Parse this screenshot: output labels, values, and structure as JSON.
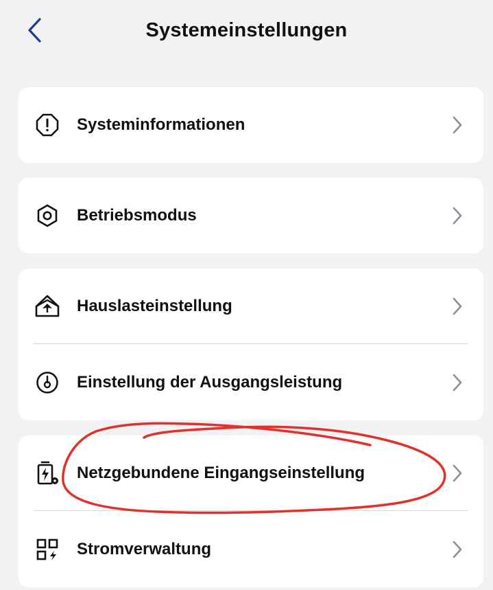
{
  "header": {
    "title": "Systemeinstellungen",
    "back_icon": "chevron-left-icon"
  },
  "colors": {
    "background": "#f2f2f4",
    "card": "#ffffff",
    "accent_back": "#1f3c8f",
    "chevron": "#8a8f9b",
    "annotation": "#e2312b"
  },
  "groups": [
    {
      "items": [
        {
          "label": "Systeminformationen",
          "icon": "alert-octagon-icon"
        }
      ]
    },
    {
      "items": [
        {
          "label": "Betriebsmodus",
          "icon": "hexagon-nut-icon"
        }
      ]
    },
    {
      "items": [
        {
          "label": "Hauslasteinstellung",
          "icon": "house-load-icon"
        },
        {
          "label": "Einstellung der Ausgangsleistung",
          "icon": "output-power-icon"
        }
      ]
    },
    {
      "items": [
        {
          "label": "Netzgebundene Eingangseinstellung",
          "icon": "battery-charge-settings-icon"
        },
        {
          "label": "Stromverwaltung",
          "icon": "power-management-grid-icon"
        }
      ]
    }
  ]
}
